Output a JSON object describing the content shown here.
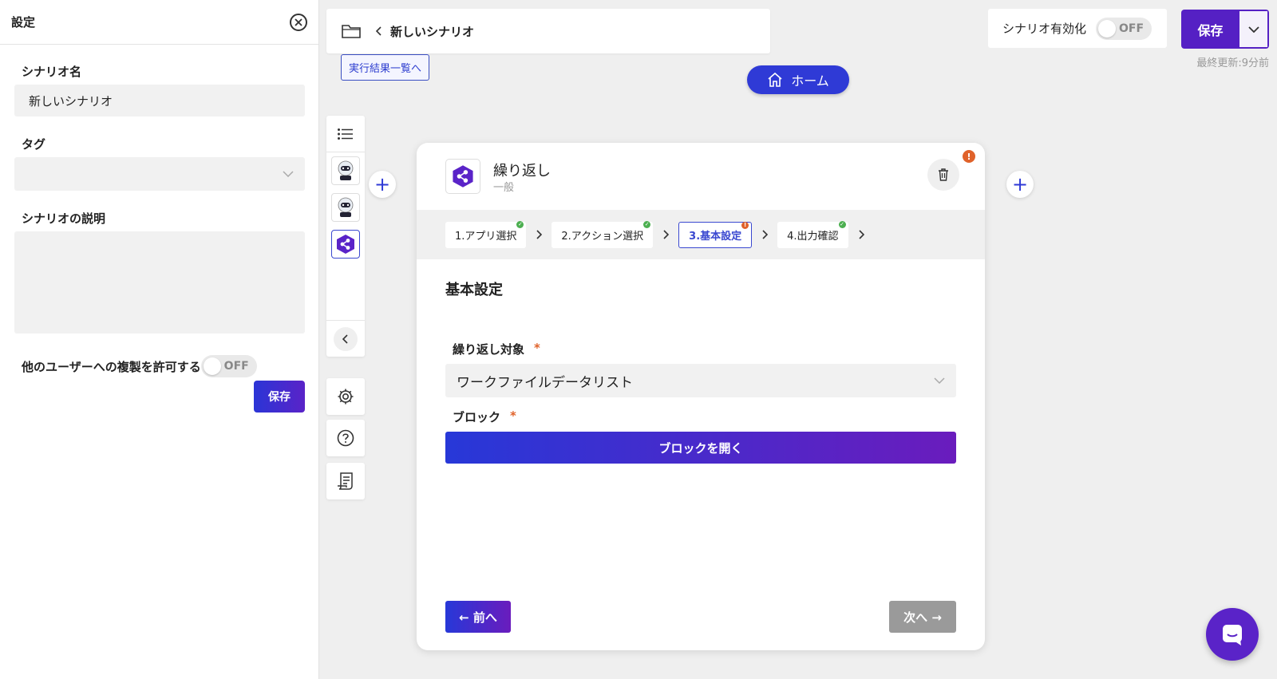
{
  "settings": {
    "title": "設定",
    "scenario_name_label": "シナリオ名",
    "scenario_name_value": "新しいシナリオ",
    "tag_label": "タグ",
    "description_label": "シナリオの説明",
    "allow_copy_label": "他のユーザーへの複製を許可する",
    "allow_copy_toggle": "OFF",
    "save_label": "保存"
  },
  "header": {
    "scenario_title": "新しいシナリオ",
    "results_link": "実行結果一覧へ",
    "home_label": "ホーム",
    "enable_label": "シナリオ有効化",
    "enable_toggle": "OFF",
    "save_label": "保存",
    "last_updated": "最終更新:9分前"
  },
  "card": {
    "title": "繰り返し",
    "subtitle": "一般",
    "warning_badge": "!",
    "steps": [
      {
        "label": "1.アプリ選択",
        "status": "done"
      },
      {
        "label": "2.アクション選択",
        "status": "done"
      },
      {
        "label": "3.基本設定",
        "status": "warning"
      },
      {
        "label": "4.出力確認",
        "status": "done"
      }
    ],
    "section_title": "基本設定",
    "repeat_target_label": "繰り返し対象",
    "repeat_target_value": "ワークファイルデータリスト",
    "block_label": "ブロック",
    "required_mark": "*",
    "open_block_label": "ブロックを開く",
    "prev_label": "← 前へ",
    "next_label": "次へ →"
  },
  "colors": {
    "accent": "#2f3ad6",
    "brand_purple": "#5520c4",
    "warning": "#e0622a",
    "success": "#4caf50"
  },
  "icons": [
    "folder-icon",
    "chevron-left-icon",
    "home-icon",
    "chevron-down-icon",
    "list-icon",
    "robot-icon",
    "app-logo-icon",
    "gear-icon",
    "help-icon",
    "log-icon",
    "trash-icon",
    "plus-icon",
    "chat-icon",
    "close-icon"
  ]
}
